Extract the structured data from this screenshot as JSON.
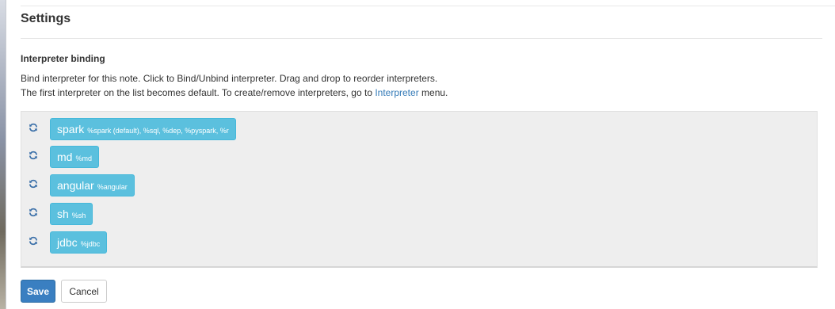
{
  "settings": {
    "title": "Settings"
  },
  "interpreter_binding": {
    "section_title": "Interpreter binding",
    "help_line1": "Bind interpreter for this note. Click to Bind/Unbind interpreter. Drag and drop to reorder interpreters.",
    "help_line2_prefix": "The first interpreter on the list becomes default. To create/remove interpreters, go to ",
    "help_line2_link": "Interpreter",
    "help_line2_suffix": " menu.",
    "interpreters": [
      {
        "name": "spark",
        "aliases": "%spark (default), %sql, %dep, %pyspark, %r"
      },
      {
        "name": "md",
        "aliases": "%md"
      },
      {
        "name": "angular",
        "aliases": "%angular"
      },
      {
        "name": "sh",
        "aliases": "%sh"
      },
      {
        "name": "jdbc",
        "aliases": "%jdbc"
      }
    ],
    "refresh_icon": "refresh-icon",
    "button_color": "#5bc0de"
  },
  "actions": {
    "save_label": "Save",
    "cancel_label": "Cancel",
    "save_color": "#3a7fc1"
  }
}
